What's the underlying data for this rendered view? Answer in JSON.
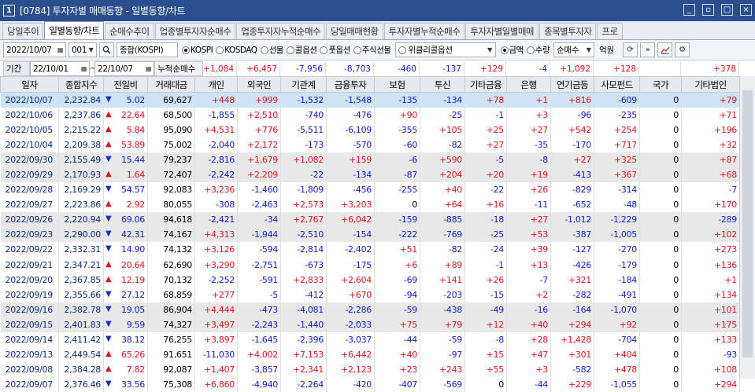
{
  "window": {
    "num": "1",
    "title": "[0784] 투자자별 매매동향 - 일별동향/차트",
    "btn_min": "_",
    "btn_max": "□",
    "btn_restore": "▫",
    "btn_close": "×"
  },
  "tabs": [
    "당일추이",
    "일별동향/차트",
    "순매수추이",
    "업종별투자자순매수",
    "업종투자자누적순매수",
    "당일매매현황",
    "투자자별누적순매수",
    "투자자별일별매매",
    "종목별투자자",
    "프로"
  ],
  "active_tab": 1,
  "toolbar": {
    "date": "2022/10/07",
    "code": "001",
    "market_name": "종합(KOSPI)",
    "markets": [
      {
        "label": "KOSPI",
        "on": true
      },
      {
        "label": "KOSDAQ",
        "on": false
      },
      {
        "label": "선물",
        "on": false
      },
      {
        "label": "콜옵션",
        "on": false
      },
      {
        "label": "풋옵션",
        "on": false
      },
      {
        "label": "주식선물",
        "on": false
      }
    ],
    "weekly_option": "위클리콜옵션",
    "units": [
      {
        "label": "금액",
        "on": true
      },
      {
        "label": "수량",
        "on": false
      }
    ],
    "net_buy_select": "순매수",
    "unit_label": "억원"
  },
  "range": {
    "label": "기간",
    "from": "22/10/01",
    "tilde": "~",
    "to": "22/10/07",
    "sum_label": "누적순매수"
  },
  "sums": [
    "+1,084",
    "+6,457",
    "-7,956",
    "-8,703",
    "-460",
    "-137",
    "+129",
    "-4",
    "+1,092",
    "+128",
    "",
    "+378"
  ],
  "columns": [
    "일자",
    "종합지수",
    "전일비",
    "거래대금",
    "개인",
    "외국인",
    "기관계",
    "금융투자",
    "보험",
    "투신",
    "기타금융",
    "은행",
    "연기금등",
    "사모펀드",
    "국가",
    "기타법인"
  ],
  "rows": [
    [
      "2022/10/07",
      "2,232.84",
      "dn",
      "5.02",
      "69,627",
      "+448",
      "+999",
      "-1,532",
      "-1,548",
      "-135",
      "-134",
      "+78",
      "+1",
      "+816",
      "-609",
      "0",
      "+79"
    ],
    [
      "2022/10/06",
      "2,237.86",
      "up",
      "22.64",
      "68,500",
      "-1,855",
      "+2,510",
      "-740",
      "-476",
      "+90",
      "-25",
      "-1",
      "+3",
      "-96",
      "-235",
      "0",
      "+71"
    ],
    [
      "2022/10/05",
      "2,215.22",
      "up",
      "5.84",
      "95,090",
      "+4,531",
      "+776",
      "-5,511",
      "-6,109",
      "-355",
      "+105",
      "+25",
      "+27",
      "+542",
      "+254",
      "0",
      "+196"
    ],
    [
      "2022/10/04",
      "2,209.38",
      "up",
      "53.89",
      "75,002",
      "-2,040",
      "+2,172",
      "-173",
      "-570",
      "-60",
      "-82",
      "+27",
      "-35",
      "-170",
      "+717",
      "0",
      "+32"
    ],
    [
      "2022/09/30",
      "2,155.49",
      "dn",
      "15.44",
      "79,237",
      "-2,816",
      "+1,679",
      "+1,082",
      "+159",
      "-6",
      "+590",
      "-5",
      "-8",
      "+27",
      "+325",
      "0",
      "+87"
    ],
    [
      "2022/09/29",
      "2,170.93",
      "up",
      "1.64",
      "72,407",
      "-2,242",
      "+2,209",
      "-22",
      "-134",
      "-87",
      "+204",
      "+20",
      "+19",
      "-413",
      "+367",
      "0",
      "+68"
    ],
    [
      "2022/09/28",
      "2,169.29",
      "dn",
      "54.57",
      "92,083",
      "+3,236",
      "-1,460",
      "-1,809",
      "-456",
      "-255",
      "+40",
      "-22",
      "+26",
      "-829",
      "-314",
      "0",
      "-7"
    ],
    [
      "2022/09/27",
      "2,223.86",
      "up",
      "2.92",
      "80,055",
      "-308",
      "-2,463",
      "+2,573",
      "+3,203",
      "0",
      "+64",
      "+16",
      "-11",
      "-652",
      "-48",
      "0",
      "+170"
    ],
    [
      "2022/09/26",
      "2,220.94",
      "dn",
      "69.06",
      "94,618",
      "-2,421",
      "-34",
      "+2,767",
      "+6,042",
      "-159",
      "-885",
      "-18",
      "+27",
      "-1,012",
      "-1,229",
      "0",
      "-289"
    ],
    [
      "2022/09/23",
      "2,290.00",
      "dn",
      "42.31",
      "74,167",
      "+4,313",
      "-1,944",
      "-2,510",
      "-154",
      "-222",
      "-769",
      "-25",
      "+53",
      "-387",
      "-1,005",
      "0",
      "+102"
    ],
    [
      "2022/09/22",
      "2,332.31",
      "dn",
      "14.90",
      "74,132",
      "+3,126",
      "-594",
      "-2,814",
      "-2,402",
      "+51",
      "-82",
      "-24",
      "+39",
      "-127",
      "-270",
      "0",
      "+273"
    ],
    [
      "2022/09/21",
      "2,347.21",
      "up",
      "20.64",
      "62,690",
      "+3,290",
      "-2,751",
      "-673",
      "-175",
      "+6",
      "+89",
      "-1",
      "+13",
      "-426",
      "-179",
      "0",
      "+136"
    ],
    [
      "2022/09/20",
      "2,367.85",
      "up",
      "12.19",
      "70,132",
      "-2,252",
      "-591",
      "+2,833",
      "+2,604",
      "-69",
      "+141",
      "+26",
      "-7",
      "+321",
      "-184",
      "0",
      "+1"
    ],
    [
      "2022/09/19",
      "2,355.66",
      "dn",
      "27.12",
      "68,859",
      "+277",
      "-5",
      "-412",
      "+670",
      "-94",
      "-203",
      "-15",
      "+2",
      "-282",
      "-491",
      "0",
      "+134"
    ],
    [
      "2022/09/16",
      "2,382.78",
      "dn",
      "19.05",
      "86,904",
      "+4,444",
      "-473",
      "-4,081",
      "-2,286",
      "-59",
      "-438",
      "-49",
      "-16",
      "-164",
      "-1,070",
      "0",
      "+101"
    ],
    [
      "2022/09/15",
      "2,401.83",
      "dn",
      "9.59",
      "74,327",
      "+3,497",
      "-2,243",
      "-1,440",
      "-2,033",
      "+75",
      "+79",
      "+12",
      "+40",
      "+294",
      "+92",
      "0",
      "+175"
    ],
    [
      "2022/09/14",
      "2,411.42",
      "dn",
      "38.12",
      "76,255",
      "+3,897",
      "-1,645",
      "-2,396",
      "-3,037",
      "-44",
      "-59",
      "-8",
      "+28",
      "+1,428",
      "-704",
      "0",
      "+133"
    ],
    [
      "2022/09/13",
      "2,449.54",
      "up",
      "65.26",
      "91,651",
      "-11,030",
      "+4,002",
      "+7,153",
      "+6,442",
      "+40",
      "-97",
      "+15",
      "+47",
      "+301",
      "+404",
      "0",
      "-93"
    ],
    [
      "2022/09/08",
      "2,384.28",
      "up",
      "7.82",
      "92,087",
      "+1,407",
      "-3,857",
      "+2,341",
      "+2,123",
      "+23",
      "+243",
      "+55",
      "+3",
      "-582",
      "+478",
      "0",
      "+108"
    ],
    [
      "2022/09/07",
      "2,376.46",
      "dn",
      "33.56",
      "75,308",
      "+6,860",
      "-4,940",
      "-2,264",
      "-420",
      "-407",
      "-569",
      "0",
      "-44",
      "+229",
      "-1,055",
      "0",
      "+294"
    ]
  ],
  "colors": {
    "title_bg": "#2b4f8e",
    "up": "#e0141e",
    "down": "#1420c8",
    "selected_row": "#cfe3f7"
  }
}
